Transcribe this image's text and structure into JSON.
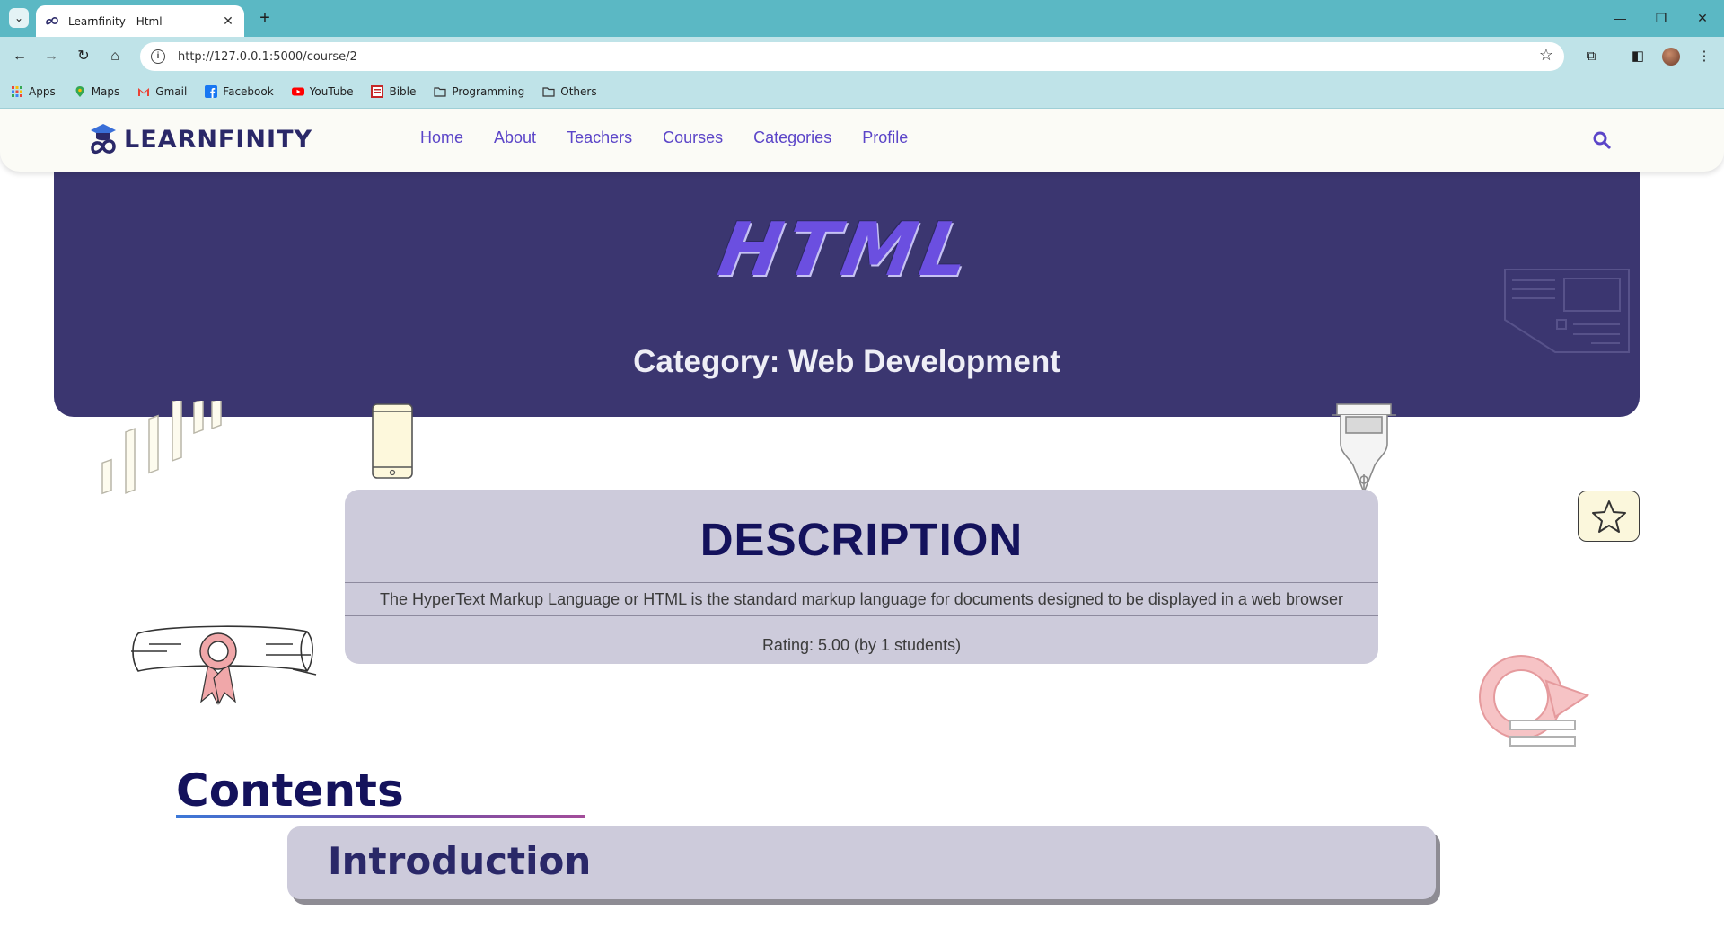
{
  "browser": {
    "tab_title": "Learnfinity - Html",
    "url": "http://127.0.0.1:5000/course/2",
    "bookmarks": [
      {
        "label": "Apps",
        "icon": "apps-grid-icon"
      },
      {
        "label": "Maps",
        "icon": "maps-pin-icon"
      },
      {
        "label": "Gmail",
        "icon": "gmail-icon"
      },
      {
        "label": "Facebook",
        "icon": "facebook-icon"
      },
      {
        "label": "YouTube",
        "icon": "youtube-icon"
      },
      {
        "label": "Bible",
        "icon": "bible-icon"
      },
      {
        "label": "Programming",
        "icon": "folder-icon"
      },
      {
        "label": "Others",
        "icon": "folder-icon"
      }
    ]
  },
  "site": {
    "logo_text": "LEARNFINITY",
    "nav": [
      "Home",
      "About",
      "Teachers",
      "Courses",
      "Categories",
      "Profile"
    ],
    "accent_color": "#5b45c8"
  },
  "course": {
    "title": "HTML",
    "category": "Category: Web Development",
    "description_heading": "DESCRIPTION",
    "description": "The HyperText Markup Language or HTML is the standard markup language for documents designed to be displayed in a web browser",
    "rating": "Rating: 5.00 (by 1 students)"
  },
  "contents": {
    "heading": "Contents",
    "items": [
      "Introduction"
    ]
  }
}
